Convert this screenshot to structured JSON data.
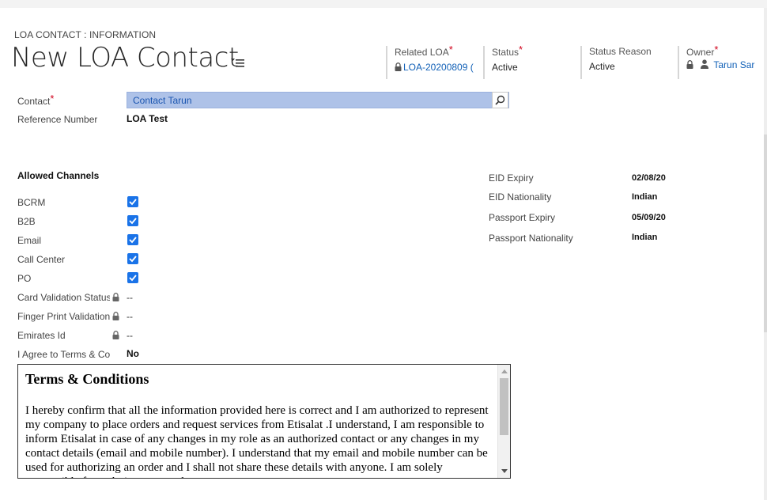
{
  "header": {
    "entity_label": "LOA CONTACT : INFORMATION",
    "title": "New LOA Contact",
    "fields": [
      {
        "label": "Related LOA",
        "required": "*",
        "value": "LOA-20200809 (",
        "locked": true,
        "link": true
      },
      {
        "label": "Status",
        "required": "*",
        "value": "Active"
      },
      {
        "label": "Status Reason",
        "value": "Active"
      },
      {
        "label": "Owner",
        "required": "*",
        "value": "Tarun Sar",
        "locked": true,
        "link": true
      }
    ]
  },
  "form": {
    "contact_label": "Contact",
    "contact_required": "*",
    "contact_value": "Contact Tarun",
    "reference_label": "Reference Number",
    "reference_value": "LOA Test",
    "section_title": "Allowed Channels",
    "channels": [
      {
        "label": "BCRM",
        "checked": true
      },
      {
        "label": "B2B",
        "checked": true
      },
      {
        "label": "Email",
        "checked": true
      },
      {
        "label": "Call Center",
        "checked": true
      },
      {
        "label": "PO",
        "checked": true
      }
    ],
    "locked_fields": [
      {
        "label": "Card Validation Status",
        "value": "--"
      },
      {
        "label": "Finger Print Validation",
        "value": "--"
      },
      {
        "label": "Emirates Id",
        "value": "--"
      }
    ],
    "agree_label": "I Agree to Terms & Conditions",
    "agree_value": "No"
  },
  "details": [
    {
      "label": "EID Expiry",
      "value": "02/08/20"
    },
    {
      "label": "EID Nationality",
      "value": "Indian"
    },
    {
      "label": "Passport Expiry",
      "value": "05/09/20"
    },
    {
      "label": "Passport Nationality",
      "value": "Indian"
    }
  ],
  "terms": {
    "heading": "Terms & Conditions",
    "body": "I hereby confirm that all the information provided here is correct and I am authorized to represent my company to place orders and request services from Etisalat .I understand, I am responsible to inform Etisalat in case of any changes in my role as an authorized contact or any changes in my contact details (email and mobile number). I understand that my email and mobile number can be used for authorizing an order and I shall not share these details with anyone. I am solely responsible for ordering any products"
  },
  "colors": {
    "checkbox": "#1a73e8",
    "link": "#1160b7",
    "required": "#d0021b",
    "lookup_highlight": "#aec2e8"
  },
  "icons": {
    "title_menu": "hamburger-menu-icon",
    "lock": "lock-icon",
    "search": "search-icon",
    "user": "user-icon"
  }
}
